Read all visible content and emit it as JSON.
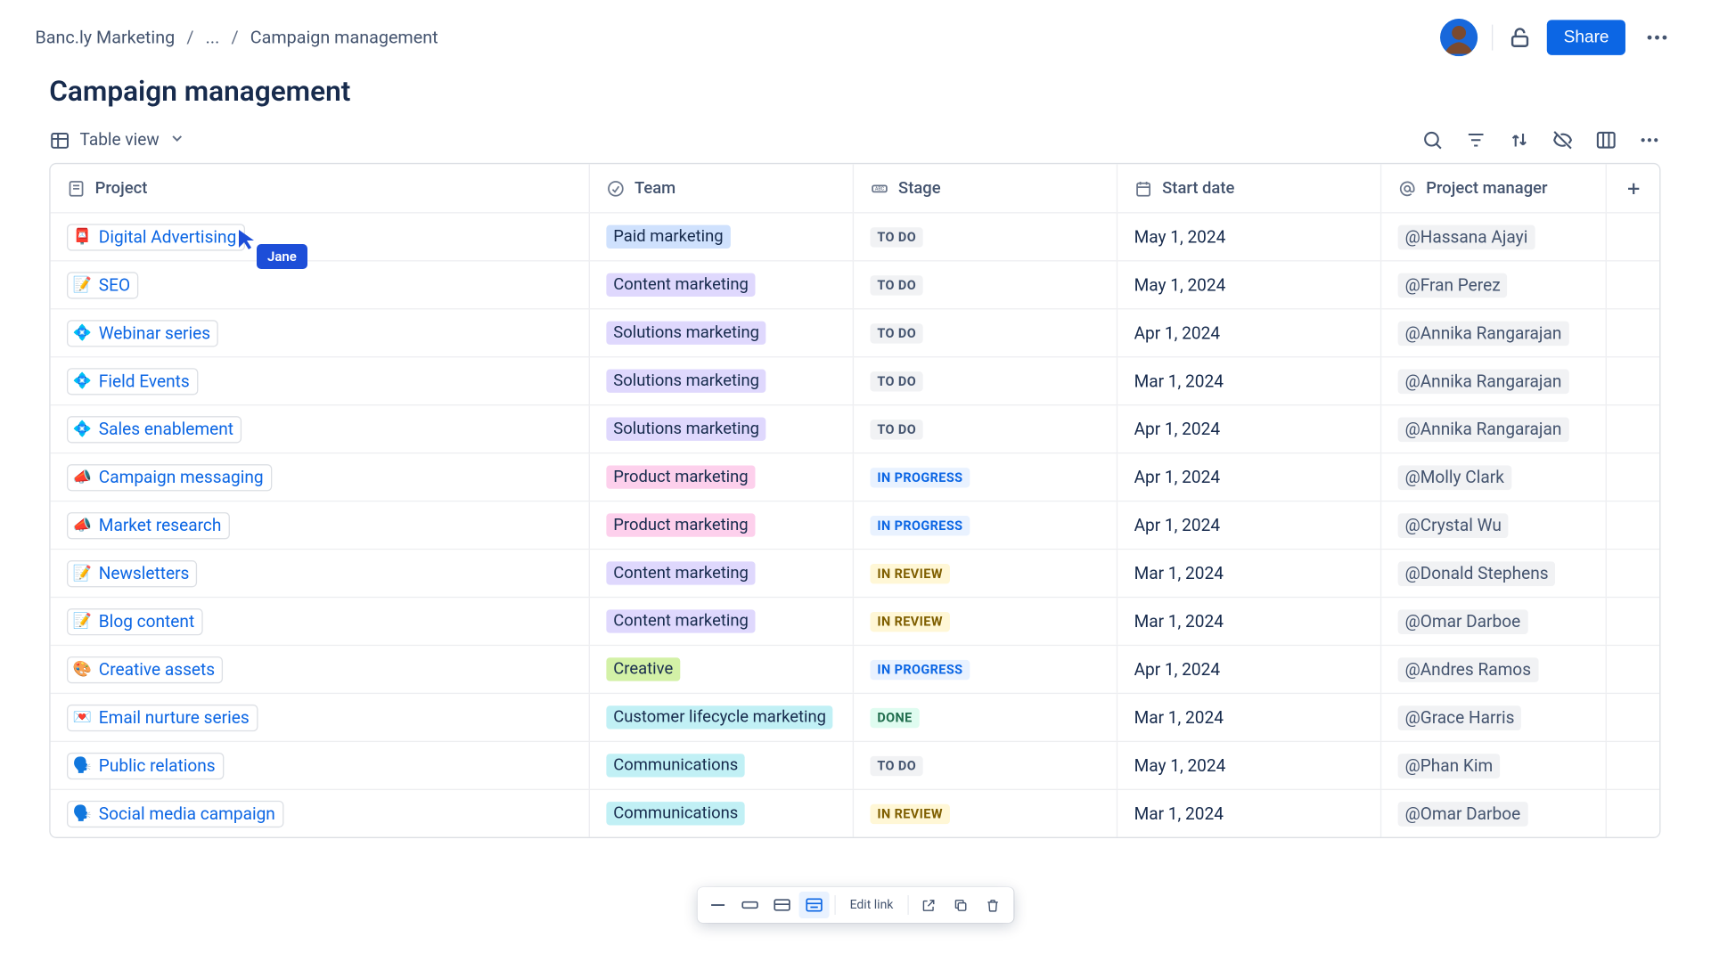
{
  "breadcrumb": {
    "root": "Banc.ly Marketing",
    "ellipsis": "...",
    "current": "Campaign management"
  },
  "header": {
    "share_label": "Share"
  },
  "page_title": "Campaign management",
  "view": {
    "label": "Table view"
  },
  "link_toolbar": {
    "edit_label": "Edit link"
  },
  "presence": {
    "name": "Jane"
  },
  "columns": {
    "project": "Project",
    "team": "Team",
    "stage": "Stage",
    "start_date": "Start date",
    "manager": "Project manager"
  },
  "rows": [
    {
      "emoji": "📮",
      "project": "Digital Advertising",
      "team": "Paid marketing",
      "team_cls": "team-paid",
      "stage": "TO DO",
      "stage_cls": "stage-todo",
      "date": "May 1, 2024",
      "pm": "@Hassana Ajayi"
    },
    {
      "emoji": "📝",
      "project": "SEO",
      "team": "Content marketing",
      "team_cls": "team-content",
      "stage": "TO DO",
      "stage_cls": "stage-todo",
      "date": "May 1, 2024",
      "pm": "@Fran Perez"
    },
    {
      "emoji": "💠",
      "project": "Webinar series",
      "team": "Solutions marketing",
      "team_cls": "team-solutions",
      "stage": "TO DO",
      "stage_cls": "stage-todo",
      "date": "Apr 1, 2024",
      "pm": "@Annika Rangarajan"
    },
    {
      "emoji": "💠",
      "project": "Field Events",
      "team": "Solutions marketing",
      "team_cls": "team-solutions",
      "stage": "TO DO",
      "stage_cls": "stage-todo",
      "date": "Mar 1, 2024",
      "pm": "@Annika Rangarajan"
    },
    {
      "emoji": "💠",
      "project": "Sales enablement",
      "team": "Solutions marketing",
      "team_cls": "team-solutions",
      "stage": "TO DO",
      "stage_cls": "stage-todo",
      "date": "Apr 1, 2024",
      "pm": "@Annika Rangarajan"
    },
    {
      "emoji": "📣",
      "project": "Campaign messaging",
      "team": "Product marketing",
      "team_cls": "team-product",
      "stage": "IN PROGRESS",
      "stage_cls": "stage-progress",
      "date": "Apr 1, 2024",
      "pm": "@Molly Clark"
    },
    {
      "emoji": "📣",
      "project": "Market research",
      "team": "Product marketing",
      "team_cls": "team-product",
      "stage": "IN PROGRESS",
      "stage_cls": "stage-progress",
      "date": "Apr 1, 2024",
      "pm": "@Crystal Wu"
    },
    {
      "emoji": "📝",
      "project": "Newsletters",
      "team": "Content marketing",
      "team_cls": "team-content",
      "stage": "IN REVIEW",
      "stage_cls": "stage-review",
      "date": "Mar 1, 2024",
      "pm": "@Donald Stephens"
    },
    {
      "emoji": "📝",
      "project": "Blog content",
      "team": "Content marketing",
      "team_cls": "team-content",
      "stage": "IN REVIEW",
      "stage_cls": "stage-review",
      "date": "Mar 1, 2024",
      "pm": "@Omar Darboe"
    },
    {
      "emoji": "🎨",
      "project": "Creative assets",
      "team": "Creative",
      "team_cls": "team-creative",
      "stage": "IN PROGRESS",
      "stage_cls": "stage-progress",
      "date": "Apr 1, 2024",
      "pm": "@Andres Ramos"
    },
    {
      "emoji": "💌",
      "project": "Email nurture series",
      "team": "Customer lifecycle marketing",
      "team_cls": "team-lifecycle",
      "stage": "DONE",
      "stage_cls": "stage-done",
      "date": "Mar 1, 2024",
      "pm": "@Grace Harris"
    },
    {
      "emoji": "🗣️",
      "project": "Public relations",
      "team": "Communications",
      "team_cls": "team-comms",
      "stage": "TO DO",
      "stage_cls": "stage-todo",
      "date": "May 1, 2024",
      "pm": "@Phan Kim"
    },
    {
      "emoji": "🗣️",
      "project": "Social media campaign",
      "team": "Communications",
      "team_cls": "team-comms",
      "stage": "IN REVIEW",
      "stage_cls": "stage-review",
      "date": "Mar 1, 2024",
      "pm": "@Omar Darboe"
    }
  ]
}
